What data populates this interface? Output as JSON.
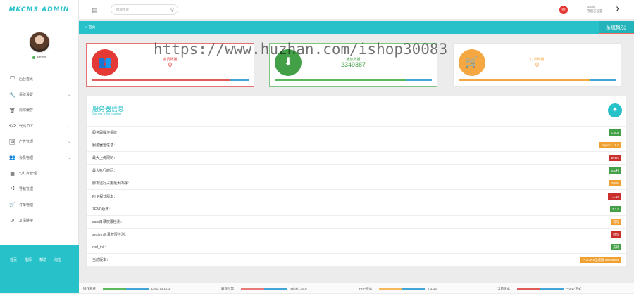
{
  "app": {
    "logo": "MKCMS ADMIN"
  },
  "user": {
    "name": "admin"
  },
  "sidebar": {
    "items": [
      {
        "icon": "🖵",
        "label": "后台首页",
        "chevron": false
      },
      {
        "icon": "🔧",
        "label": "系统设置",
        "chevron": true
      },
      {
        "icon": "🗑",
        "label": "清除缓存",
        "chevron": false
      },
      {
        "icon": "</>",
        "label": "代码 DIY",
        "chevron": true
      },
      {
        "icon": "🖼",
        "label": "广告管理",
        "chevron": true
      },
      {
        "icon": "👥",
        "label": "会员管理",
        "chevron": true
      },
      {
        "icon": "▦",
        "label": "幻灯片管理",
        "chevron": false
      },
      {
        "icon": "⤮",
        "label": "导航管理",
        "chevron": false
      },
      {
        "icon": "🛒",
        "label": "订单管理",
        "chevron": false
      },
      {
        "icon": "↗",
        "label": "友情链接",
        "chevron": false
      }
    ],
    "footer_links": [
      "首页",
      "指挥",
      "帮助",
      "淘宝"
    ]
  },
  "topbar": {
    "search_placeholder": "模糊搜索",
    "user_line1": "admin",
    "user_line2": "管理员设置"
  },
  "breadcrumb": {
    "home": "首页",
    "title": "系统概况"
  },
  "cards": [
    {
      "label": "会员数量",
      "value": "0",
      "color": "#e53935",
      "text_color": "#e53935",
      "icon": "👥",
      "bar": [
        "#e05a5a",
        "#42a5d8"
      ],
      "fill": 0.88
    },
    {
      "label": "播放数量",
      "value": "2349387",
      "color": "#43a047",
      "text_color": "#43a047",
      "icon": "⬇",
      "bar": [
        "#5cb85c",
        "#42a5d8"
      ],
      "fill": 0.84
    },
    {
      "label": "订单数量",
      "value": "0",
      "color": "#f5a742",
      "text_color": "#f5a742",
      "icon": "🛒",
      "bar": [
        "#f5a742",
        "#42a5d8"
      ],
      "fill": 0.84
    }
  ],
  "server": {
    "title": "服务器信息",
    "subtitle": "Server information",
    "rows": [
      {
        "label": "服务器操作系统",
        "value": "Linux",
        "color": "#43a047"
      },
      {
        "label": "服务器运信息：",
        "value": "nginx/1.16.0",
        "color": "#f0a030"
      },
      {
        "label": "最大上传限制：",
        "value": "290M",
        "color": "#c9302c"
      },
      {
        "label": "最大执行时间：",
        "value": "300秒",
        "color": "#43a047"
      },
      {
        "label": "脚本运行占用最大内存：",
        "value": "290M",
        "color": "#f0a030"
      },
      {
        "label": "PHP程式版本：",
        "value": "7.2.16",
        "color": "#c9302c"
      },
      {
        "label": "ZEND版本：",
        "value": "3.2.0",
        "color": "#43a047"
      },
      {
        "label": "data目录权限检测：",
        "value": "可写",
        "color": "#f0a030"
      },
      {
        "label": "system目录权限检测：",
        "value": "可写",
        "color": "#c9302c"
      },
      {
        "label": "curl_init：",
        "value": "支持",
        "color": "#43a047"
      },
      {
        "label": "当前版本：",
        "value": "Pro-v7.0正式版-20200625",
        "color": "#f0a030"
      }
    ]
  },
  "footer": [
    {
      "label": "操作系统",
      "value": "Linux (3.10.0-",
      "c1": "#5cb85c",
      "c2": "#42a5d8"
    },
    {
      "label": "解译引擎",
      "value": "nginx/1.16.0",
      "c1": "#e87a7a",
      "c2": "#42a5d8"
    },
    {
      "label": "PHP版本",
      "value": "7.2.16",
      "c1": "#f5b85a",
      "c2": "#42a5d8"
    },
    {
      "label": "当前版本",
      "value": "Pro-v7正式",
      "c1": "#e05a5a",
      "c2": "#42a5d8"
    }
  ],
  "watermark": "https://www.huzhan.com/ishop30083"
}
